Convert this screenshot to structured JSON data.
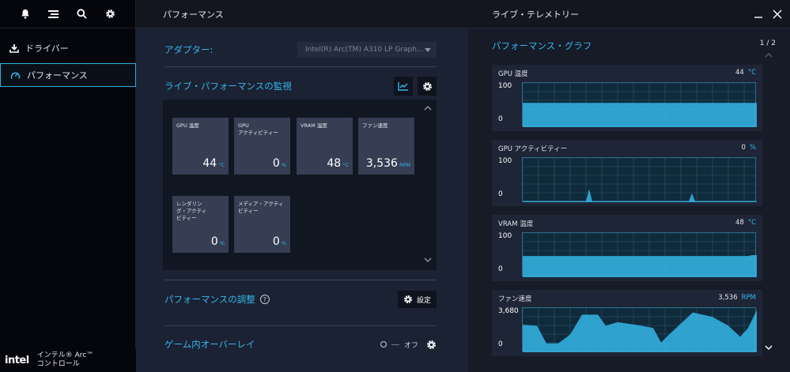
{
  "sidebar": {
    "icons": [
      "bell-icon",
      "menu-icon",
      "search-icon",
      "gear-icon"
    ],
    "items": [
      {
        "label": "ドライバー",
        "icon": "download-icon"
      },
      {
        "label": "パフォーマンス",
        "icon": "gauge-icon"
      }
    ],
    "brand": {
      "logo": "intel",
      "line1": "インテル® Arc™",
      "line2": "コントロール"
    }
  },
  "middle": {
    "header": "パフォーマンス",
    "adapter_label": "アダプター:",
    "adapter_value": "Intel(R) Arc(TM) A310 LP Graph…",
    "monitor_title": "ライブ・パフォーマンスの監視",
    "tiles": [
      {
        "label": "GPU 温度",
        "value": "44",
        "unit": "°C"
      },
      {
        "label": "GPU\nアクティビティー",
        "value": "0",
        "unit": "%"
      },
      {
        "label": "VRAM 温度",
        "value": "48",
        "unit": "°C"
      },
      {
        "label": "ファン速度",
        "value": "3,536",
        "unit": "RPM"
      },
      {
        "label": "レンダリン\nグ・アクティ\nビティー",
        "value": "0",
        "unit": "%"
      },
      {
        "label": "メディア・アクティ\nビティー",
        "value": "0",
        "unit": "%"
      }
    ],
    "tuning_title": "パフォーマンスの調整",
    "settings_label": "設定",
    "overlay_title": "ゲーム内オーバーレイ",
    "overlay_state": "オフ"
  },
  "right": {
    "header": "ライブ・テレメトリー",
    "title": "パフォーマンス・グラフ",
    "pager": "1 / 2",
    "accent": "#35b6e8",
    "charts": [
      {
        "label": "GPU 温度",
        "value": "44",
        "unit": "°C",
        "ymax": "100",
        "ymin": "0"
      },
      {
        "label": "GPU アクティビティー",
        "value": "0",
        "unit": "%",
        "ymax": "100",
        "ymin": "0"
      },
      {
        "label": "VRAM 温度",
        "value": "48",
        "unit": "°C",
        "ymax": "100",
        "ymin": "0"
      },
      {
        "label": "ファン速度",
        "value": "3,536",
        "unit": "RPM",
        "ymax": "3,680",
        "ymin": "0"
      }
    ]
  }
}
